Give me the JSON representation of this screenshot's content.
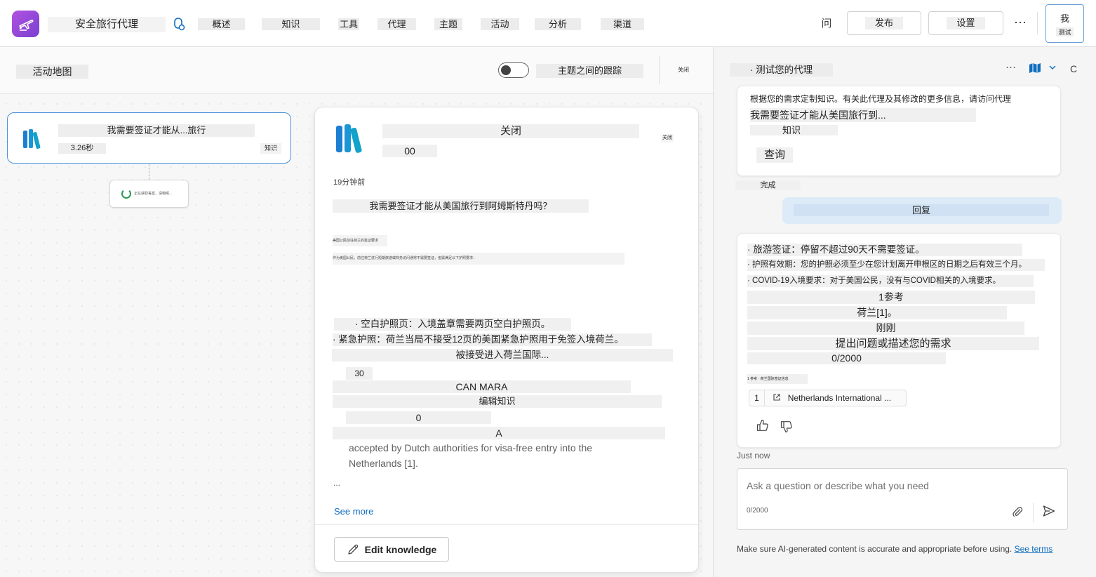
{
  "header": {
    "agent_name": "安全旅行代理",
    "tabs": [
      "概述",
      "知识",
      "工具",
      "代理",
      "主题",
      "活动",
      "分析",
      "渠道"
    ],
    "help_label": "问",
    "publish_label": "发布",
    "settings_label": "设置",
    "more_label": "···",
    "test_icon_label": "我",
    "test_label": "测试"
  },
  "activity": {
    "title": "活动地图",
    "toggle_label": "主题之间的跟踪",
    "toggle_on": false,
    "close_label": "关闭",
    "node": {
      "title": "我需要签证才能从...旅行",
      "time": "3.26秒",
      "type": "知识"
    },
    "sub_node_label": "正在获取答案，请稍候..."
  },
  "panel": {
    "title": "关闭",
    "count": "00",
    "close_label": "关闭",
    "time": "19分钟前",
    "question": "我需要签证才能从美国旅行到阿姆斯特丹吗？",
    "garble1": "美国公民前往荷兰的签证要求",
    "garble2": "作为美国公民，前往荷兰进行短期旅游或商务访问通常不需要签证，但需满足以下护照要求：",
    "lines": [
      "· 空白护照页：入境盖章需要两页空白护照页。",
      "· 紧急护照：荷兰当局不接受12页的美国紧急护照用于免签入境荷兰。",
      "被接受进入荷兰国际...",
      "30",
      "CAN MARA",
      "编辑知识",
      "0",
      "A"
    ],
    "english_text": "accepted by Dutch authorities for visa-free entry into the Netherlands [1].",
    "ellipsis": "...",
    "see_more": "See more",
    "edit_button": "Edit knowledge"
  },
  "test_pane": {
    "title": "· 测试您的代理",
    "more_label": "···",
    "refresh_label": "C",
    "card1_line1": "根据您的需求定制知识。有关此代理及其修改的更多信息，请访问代理",
    "card1_line2": "我需要签证才能从美国旅行到...",
    "card1_line3": "知识",
    "card1_button": "查询",
    "done_label": "完成",
    "user_message": "回复",
    "answer_lines": [
      "· 旅游签证：停留不超过90天不需要签证。",
      "· 护照有效期：您的护照必须至少在您计划离开申根区的日期之后有效三个月。",
      "· COVID-19入境要求：对于美国公民，没有与COVID相关的入境要求。",
      "1参考",
      "荷兰[1]。",
      "刚刚",
      "提出问题或描述您的需求",
      "0/2000"
    ],
    "answer_small": "1 参考 · 荷兰国际签证信息",
    "citation_num": "1",
    "citation_text": "Netherlands International ...",
    "timestamp": "Just now",
    "input_placeholder": "Ask a question or describe what you need",
    "char_count": "0/2000",
    "disclaimer": "Make sure AI-generated content is accurate and appropriate before using.",
    "disclaimer_link": "See terms"
  }
}
